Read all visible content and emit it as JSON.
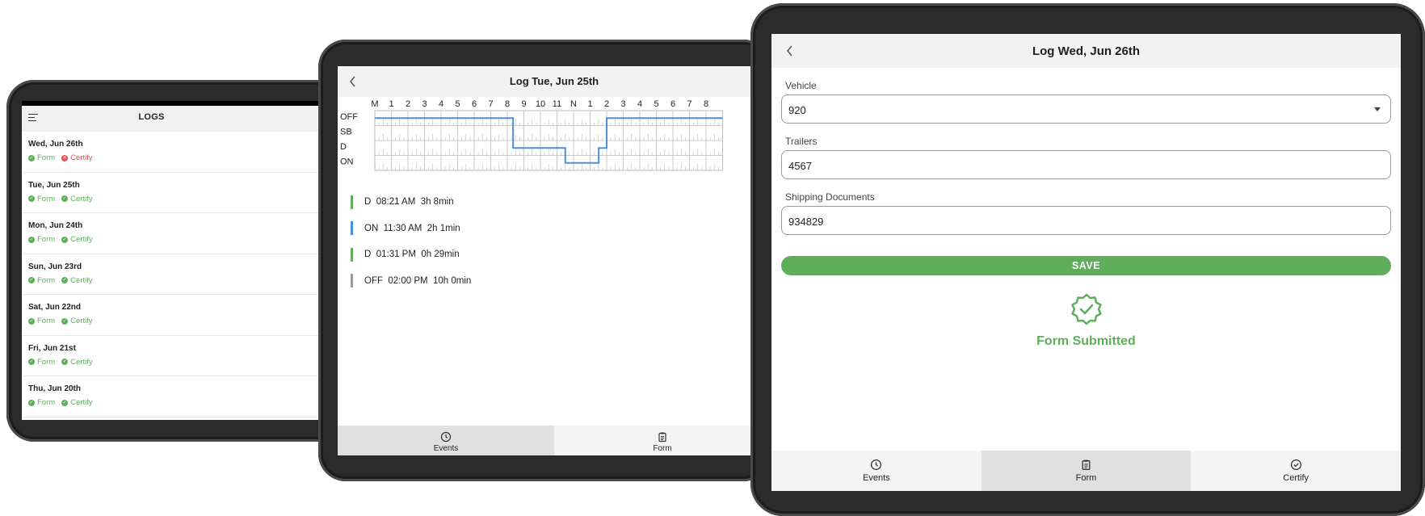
{
  "logs_tablet": {
    "title": "LOGS",
    "items": [
      {
        "date": "Wed, Jun 26th",
        "form": "Form",
        "certify": "Certify",
        "certify_ok": false
      },
      {
        "date": "Tue, Jun 25th",
        "form": "Form",
        "certify": "Certify",
        "certify_ok": true
      },
      {
        "date": "Mon, Jun 24th",
        "form": "Form",
        "certify": "Certify",
        "certify_ok": true
      },
      {
        "date": "Sun, Jun 23rd",
        "form": "Form",
        "certify": "Certify",
        "certify_ok": true
      },
      {
        "date": "Sat, Jun 22nd",
        "form": "Form",
        "certify": "Certify",
        "certify_ok": true
      },
      {
        "date": "Fri, Jun 21st",
        "form": "Form",
        "certify": "Certify",
        "certify_ok": true
      },
      {
        "date": "Thu, Jun 20th",
        "form": "Form",
        "certify": "Certify",
        "certify_ok": true
      }
    ]
  },
  "log_tue": {
    "title": "Log Tue, Jun 25th",
    "hours": [
      "M",
      "1",
      "2",
      "3",
      "4",
      "5",
      "6",
      "7",
      "8",
      "9",
      "10",
      "11",
      "N",
      "1",
      "2",
      "3",
      "4",
      "5",
      "6",
      "7",
      "8"
    ],
    "rows": [
      "OFF",
      "SB",
      "D",
      "ON"
    ],
    "events": [
      {
        "status": "D",
        "time": "08:21 AM",
        "duration": "3h 8min",
        "color": "#5fae5b"
      },
      {
        "status": "ON",
        "time": "11:30 AM",
        "duration": "2h 1min",
        "color": "#4a90d9"
      },
      {
        "status": "D",
        "time": "01:31 PM",
        "duration": "0h 29min",
        "color": "#5fae5b"
      },
      {
        "status": "OFF",
        "time": "02:00 PM",
        "duration": "10h 0min",
        "color": "#9a9a9a"
      }
    ],
    "tabs": {
      "events": "Events",
      "form": "Form"
    }
  },
  "log_wed": {
    "title": "Log Wed, Jun 26th",
    "vehicle_label": "Vehicle",
    "vehicle_value": "920",
    "trailers_label": "Trailers",
    "trailers_value": "4567",
    "shipping_label": "Shipping Documents",
    "shipping_value": "934829",
    "save_label": "SAVE",
    "submitted_text": "Form Submitted",
    "tabs": {
      "events": "Events",
      "form": "Form",
      "certify": "Certify"
    }
  },
  "colors": {
    "green": "#5fae5b",
    "red": "#e35050",
    "line_blue": "#4a90d9"
  }
}
